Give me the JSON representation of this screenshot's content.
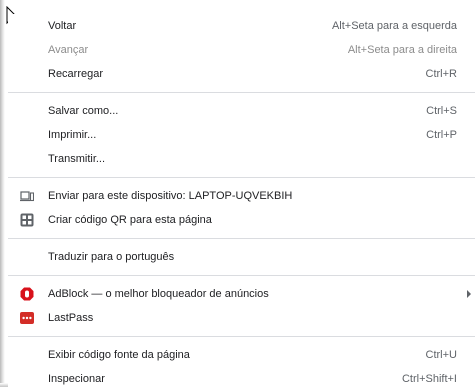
{
  "menu": {
    "back": {
      "label": "Voltar",
      "shortcut": "Alt+Seta para a esquerda"
    },
    "forward": {
      "label": "Avançar",
      "shortcut": "Alt+Seta para a direita"
    },
    "reload": {
      "label": "Recarregar",
      "shortcut": "Ctrl+R"
    },
    "save_as": {
      "label": "Salvar como...",
      "shortcut": "Ctrl+S"
    },
    "print": {
      "label": "Imprimir...",
      "shortcut": "Ctrl+P"
    },
    "cast": {
      "label": "Transmitir..."
    },
    "send_to_device": {
      "label": "Enviar para este dispositivo: LAPTOP-UQVEKBIH",
      "icon": "device-icon"
    },
    "qr_code": {
      "label": "Criar código QR para esta página",
      "icon": "qr-code-icon"
    },
    "translate": {
      "label": "Traduzir para o português"
    },
    "adblock": {
      "label": "AdBlock — o melhor bloqueador de anúncios",
      "icon": "adblock-icon",
      "has_submenu": true
    },
    "lastpass": {
      "label": "LastPass",
      "icon": "lastpass-icon"
    },
    "view_source": {
      "label": "Exibir código fonte da página",
      "shortcut": "Ctrl+U"
    },
    "inspect": {
      "label": "Inspecionar",
      "shortcut": "Ctrl+Shift+I"
    }
  },
  "colors": {
    "text": "#202124",
    "disabled_text": "#8c8c8c",
    "separator": "#dadce0",
    "adblock_red": "#d8111b",
    "lastpass_red": "#d32d27"
  }
}
